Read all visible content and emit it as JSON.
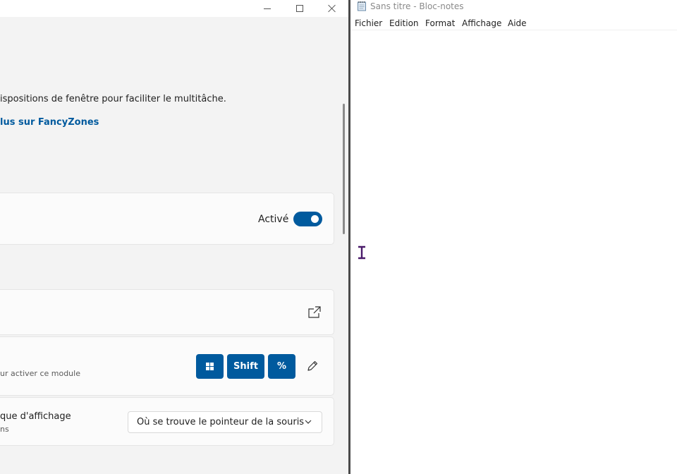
{
  "settings_window": {
    "description": "ispositions de fenêtre pour faciliter le multitâche.",
    "learn_more_link": "lus sur FancyZones",
    "enable_card": {
      "status_label": "Activé",
      "toggle_on": true
    },
    "launch_editor_card": {
      "icon": "open-external-icon"
    },
    "hotkey_card": {
      "subtitle": "ur activer ce module",
      "keys": [
        "win",
        "Shift",
        "%"
      ],
      "edit_icon": "pencil-icon"
    },
    "display_card": {
      "label": "que d'affichage",
      "subtitle": "ns",
      "dropdown_value": "Où se trouve le pointeur de la souris"
    },
    "accent_color": "#005a9e"
  },
  "notepad": {
    "title": "Sans titre - Bloc-notes",
    "menu": [
      "Fichier",
      "Edition",
      "Format",
      "Affichage",
      "Aide"
    ],
    "cursor_icon": "ibeam-cursor-icon"
  }
}
